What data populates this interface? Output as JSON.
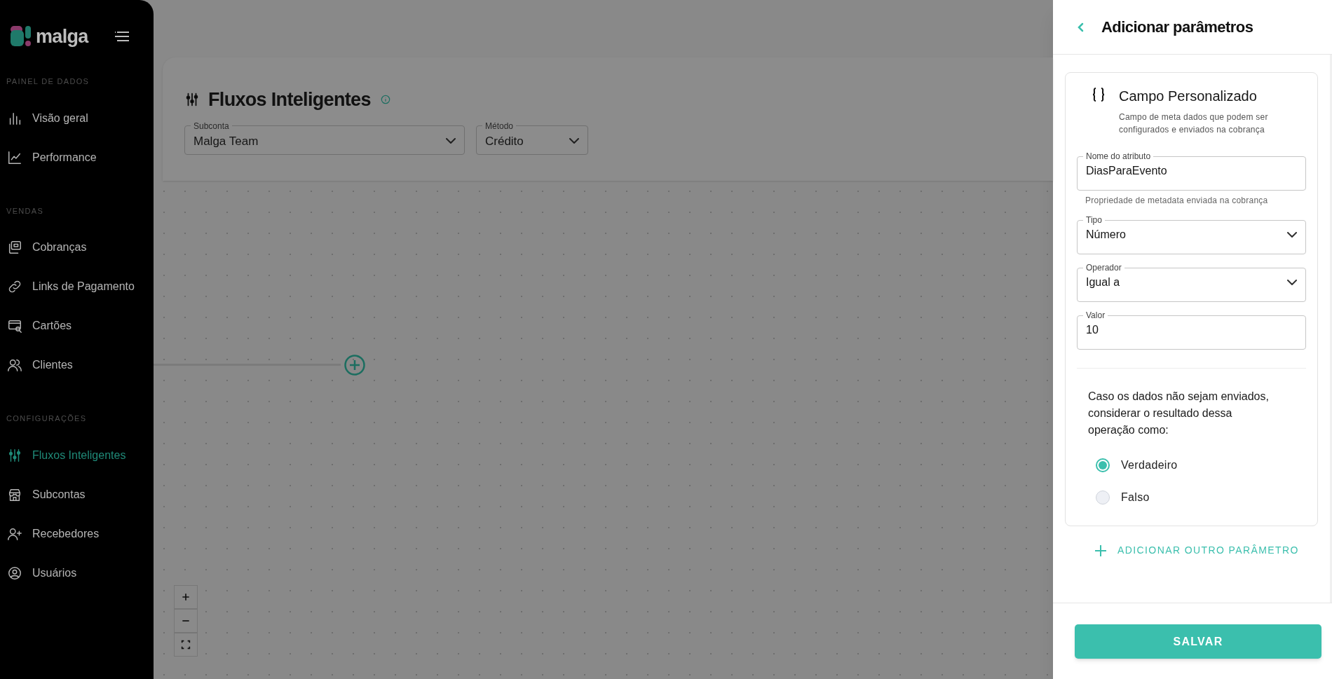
{
  "sidebar": {
    "logo": "malga",
    "sections": [
      {
        "title": "PAINEL DE DADOS",
        "items": [
          {
            "label": "Visão geral",
            "selected": false
          },
          {
            "label": "Performance",
            "selected": false
          }
        ]
      },
      {
        "title": "VENDAS",
        "items": [
          {
            "label": "Cobranças",
            "selected": false
          },
          {
            "label": "Links de Pagamento",
            "selected": false
          },
          {
            "label": "Cartões",
            "selected": false
          },
          {
            "label": "Clientes",
            "selected": false
          }
        ]
      },
      {
        "title": "CONFIGURAÇÕES",
        "items": [
          {
            "label": "Fluxos Inteligentes",
            "selected": true
          },
          {
            "label": "Subcontas",
            "selected": false
          },
          {
            "label": "Recebedores",
            "selected": false
          },
          {
            "label": "Usuários",
            "selected": false
          }
        ]
      }
    ]
  },
  "page_header": {
    "title": "Fluxos Inteligentes",
    "filters": [
      {
        "label": "Subconta",
        "value": "Malga Team"
      },
      {
        "label": "Método",
        "value": "Crédito"
      }
    ]
  },
  "panel": {
    "title": "Adicionar parâmetros",
    "card": {
      "title": "Campo Personalizado",
      "description": "Campo de meta dados que podem ser configurados e enviados na cobrança",
      "fields": [
        {
          "kind": "text",
          "label": "Nome do atributo",
          "value": "DiasParaEvento",
          "helper": "Propriedade de metadata enviada na cobrança"
        },
        {
          "kind": "select",
          "label": "Tipo",
          "value": "Número"
        },
        {
          "kind": "select",
          "label": "Operador",
          "value": "Igual a"
        },
        {
          "kind": "text",
          "label": "Valor",
          "value": "10"
        }
      ],
      "question": "Caso os dados não sejam enviados, considerar o resultado dessa operação como:",
      "options": [
        {
          "label": "Verdadeiro",
          "selected": true
        },
        {
          "label": "Falso",
          "selected": false
        }
      ]
    },
    "add_button": "ADICIONAR OUTRO PARÂMETRO",
    "save_button": "SALVAR"
  }
}
